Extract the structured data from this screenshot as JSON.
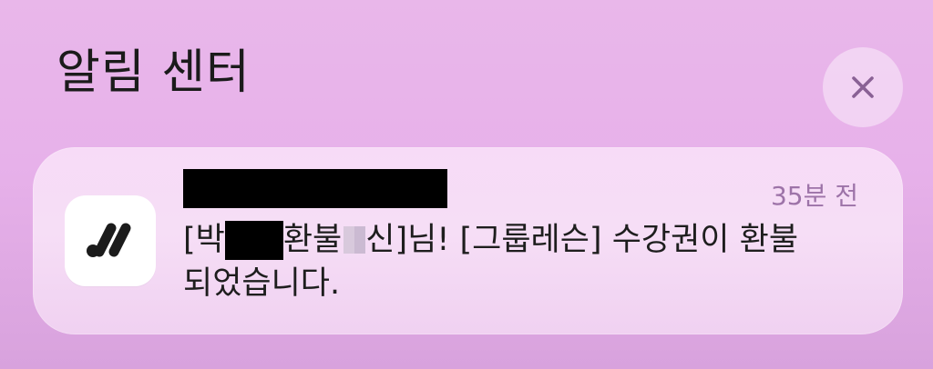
{
  "header": {
    "title": "알림 센터"
  },
  "close_button": {
    "icon": "close-icon"
  },
  "notification": {
    "app_icon": "app-logo-icon",
    "time_label": "35분 전",
    "message": {
      "part1": "[박",
      "part2": "환불",
      "part3": "신]님! [그룹레슨] 수강권이 환불",
      "part4": "되었습니다."
    }
  },
  "colors": {
    "background": "#e9b7ea",
    "card": "#f6def6",
    "title": "#1b1b1b",
    "close_icon": "#8a6195",
    "time": "#9d73a8"
  }
}
